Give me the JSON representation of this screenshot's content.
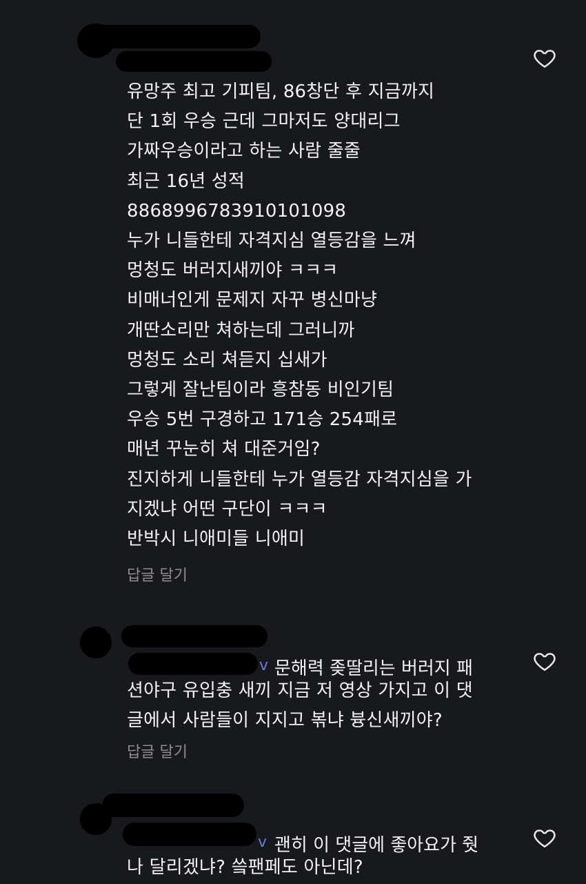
{
  "comments": [
    {
      "lines": [
        "유망주 최고 기피팀, 86창단 후 지금까지",
        "단 1회 우승 근데 그마저도 양대리그",
        "가짜우승이라고 하는 사람 줄줄",
        "최근 16년 성적",
        "8868996783910101098",
        "누가 니들한테 자격지심 열등감을 느껴",
        "멍청도 버러지새끼야 ㅋㅋㅋ",
        "비매너인게 문제지 자꾸 병신마냥",
        "개딴소리만 쳐하는데 그러니까",
        "멍청도 소리 쳐듣지 십새가",
        "그렇게 잘난팀이라 흥참동 비인기팀",
        "우승 5번 구경하고 171승 254패로",
        "매년 꾸눈히 쳐 대준거임?",
        "진지하게 니들한테 누가 열등감 자격지심을 가",
        "지겠냐 어떤 구단이 ㅋㅋㅋ",
        "반박시 니애미들 니애미"
      ],
      "reply_label": "답글 달기",
      "like_icon": "heart-outline-icon"
    },
    {
      "mention_tail": "v",
      "first_line": "문해력 좆딸리는 버러지 패",
      "lines": [
        "션야구 유입충 새끼 지금 저 영상 가지고 이 댓",
        "글에서 사람들이 지지고 볶냐 븅신새끼야?"
      ],
      "reply_label": "답글 달기",
      "like_icon": "heart-outline-icon"
    },
    {
      "mention_tail": "v",
      "first_line": "괜히 이 댓글에 좋아요가 줫",
      "lines": [
        "나 달리겠냐? 씈팬페도 아닌데?"
      ],
      "like_icon": "heart-outline-icon"
    }
  ],
  "colors": {
    "background": "#18191c",
    "text": "#f2f2f2",
    "secondary": "#8e8e93",
    "mention": "#6e7bd9"
  }
}
